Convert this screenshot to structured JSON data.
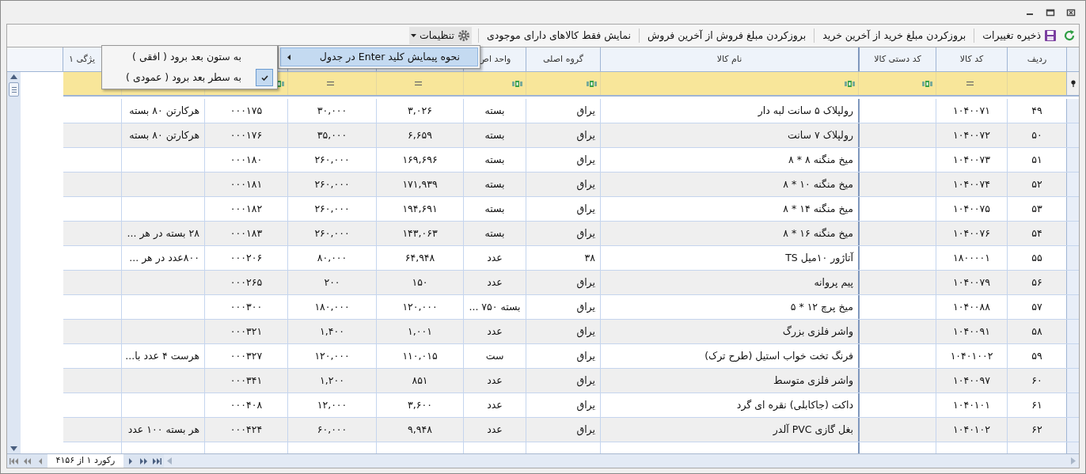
{
  "toolbar": {
    "buttons": [
      {
        "kind": "save",
        "label": "ذخیره تغییرات"
      },
      {
        "kind": "text",
        "label": "بروزکردن مبلغ خرید از آخرین خرید"
      },
      {
        "kind": "text",
        "label": "بروزکردن مبلغ فروش از آخرین فروش"
      },
      {
        "kind": "text",
        "label": "نمایش فقط کالاهای دارای موجودی"
      }
    ],
    "settings": {
      "label": "تنظیمات",
      "expanded": true,
      "items": [
        {
          "label": "نحوه پیمایش کلید Enter در جدول",
          "highlighted": true,
          "submenu": [
            {
              "label": "به ستون بعد برود ( افقی )",
              "checked": false
            },
            {
              "label": "به سطر بعد برود ( عمودی )",
              "checked": true
            }
          ]
        }
      ]
    }
  },
  "table": {
    "columns": [
      {
        "header": "ردیف",
        "kind": "plain"
      },
      {
        "header": "کد کالا",
        "kind": "equals"
      },
      {
        "header": "کد دستی کالا",
        "kind": "text"
      },
      {
        "header": "نام کالا",
        "kind": "text"
      },
      {
        "header": "گروه اصلی",
        "kind": "text"
      },
      {
        "header": "واحد اص",
        "kind": "text"
      },
      {
        "kind": "equals"
      },
      {
        "kind": "equals"
      },
      {
        "kind": "text"
      },
      {
        "kind": "plain"
      },
      {
        "header": "یژگی ۱",
        "kind": "plain"
      }
    ],
    "rows": [
      {
        "row": "۴۹",
        "code": "۱۰۴۰۰۷۱",
        "name": "رولپلاک ۵ سانت لبه دار",
        "group": "یراق",
        "unit": "بسته",
        "column_7": "۳,۰۲۶",
        "column_8": "۳۰,۰۰۰",
        "column_9": "۰۰۰۱۷۵",
        "column_10": "هرکارتن ۸۰ بسته"
      },
      {
        "row": "۵۰",
        "code": "۱۰۴۰۰۷۲",
        "name": "رولپلاک ۷ سانت",
        "group": "یراق",
        "unit": "بسته",
        "column_7": "۶,۶۵۹",
        "column_8": "۳۵,۰۰۰",
        "column_9": "۰۰۰۱۷۶",
        "column_10": "هرکارتن ۸۰ بسته"
      },
      {
        "row": "۵۱",
        "code": "۱۰۴۰۰۷۳",
        "name": "میخ منگنه  ۸ * ۸",
        "group": "یراق",
        "unit": "بسته",
        "column_7": "۱۶۹,۶۹۶",
        "column_8": "۲۶۰,۰۰۰",
        "column_9": "۰۰۰۱۸۰"
      },
      {
        "row": "۵۲",
        "code": "۱۰۴۰۰۷۴",
        "name": "میخ منگنه  ۱۰ * ۸",
        "group": "یراق",
        "unit": "بسته",
        "column_7": "۱۷۱,۹۳۹",
        "column_8": "۲۶۰,۰۰۰",
        "column_9": "۰۰۰۱۸۱"
      },
      {
        "row": "۵۳",
        "code": "۱۰۴۰۰۷۵",
        "name": "میخ منگنه  ۱۴ * ۸",
        "group": "یراق",
        "unit": "بسته",
        "column_7": "۱۹۴,۶۹۱",
        "column_8": "۲۶۰,۰۰۰",
        "column_9": "۰۰۰۱۸۲"
      },
      {
        "row": "۵۴",
        "code": "۱۰۴۰۰۷۶",
        "name": "میخ منگنه  ۱۶ * ۸",
        "group": "یراق",
        "unit": "بسته",
        "column_7": "۱۴۳,۰۶۳",
        "column_8": "۲۶۰,۰۰۰",
        "column_9": "۰۰۰۱۸۳",
        "column_10": "۲۸ بسته در هر ..."
      },
      {
        "row": "۵۵",
        "code": "۱۸۰۰۰۰۱",
        "name": "آتاژور ۱۰میل  TS",
        "group": "۳۸",
        "unit": "عدد",
        "column_7": "۶۴,۹۴۸",
        "column_8": "۸۰,۰۰۰",
        "column_9": "۰۰۰۲۰۶",
        "column_10": "۸۰۰عدد در هر ..."
      },
      {
        "row": "۵۶",
        "code": "۱۰۴۰۰۷۹",
        "name": "پیم پروانه",
        "group": "یراق",
        "unit": "عدد",
        "column_7": "۱۵۰",
        "column_8": "۲۰۰",
        "column_9": "۰۰۰۲۶۵"
      },
      {
        "row": "۵۷",
        "code": "۱۰۴۰۰۸۸",
        "name": "میخ پرچ  ۱۲ * ۵",
        "group": "یراق",
        "unit": "بسته ۷۵۰ ...",
        "column_7": "۱۲۰,۰۰۰",
        "column_8": "۱۸۰,۰۰۰",
        "column_9": "۰۰۰۳۰۰"
      },
      {
        "row": "۵۸",
        "code": "۱۰۴۰۰۹۱",
        "name": "واشر فلزی بزرگ",
        "group": "یراق",
        "unit": "عدد",
        "column_7": "۱,۰۰۱",
        "column_8": "۱,۴۰۰",
        "column_9": "۰۰۰۳۲۱"
      },
      {
        "row": "۵۹",
        "code": "۱۰۴۰۱۰۰۲",
        "name": "فرنگ تخت خواب استیل (طرح ترک)",
        "group": "یراق",
        "unit": "ست",
        "column_7": "۱۱۰,۰۱۵",
        "column_8": "۱۲۰,۰۰۰",
        "column_9": "۰۰۰۳۲۷",
        "column_10": "هرست ۴ عدد با..."
      },
      {
        "row": "۶۰",
        "code": "۱۰۴۰۰۹۷",
        "name": "واشر فلزی متوسط",
        "group": "یراق",
        "unit": "عدد",
        "column_7": "۸۵۱",
        "column_8": "۱,۲۰۰",
        "column_9": "۰۰۰۳۴۱"
      },
      {
        "row": "۶۱",
        "code": "۱۰۴۰۱۰۱",
        "name": "داکت (جاکابلی) نقره ای گرد",
        "group": "یراق",
        "unit": "عدد",
        "column_7": "۳,۶۰۰",
        "column_8": "۱۲,۰۰۰",
        "column_9": "۰۰۰۴۰۸"
      },
      {
        "row": "۶۲",
        "code": "۱۰۴۰۱۰۲",
        "name": "بغل گازی PVC  آلدر",
        "group": "یراق",
        "unit": "عدد",
        "column_7": "۹,۹۴۸",
        "column_8": "۶۰,۰۰۰",
        "column_9": "۰۰۰۴۲۴",
        "column_10": "هر بسته ۱۰۰ عدد"
      }
    ]
  },
  "navigator": {
    "record": "رکورد ۱ از ۴۱۵۶"
  }
}
